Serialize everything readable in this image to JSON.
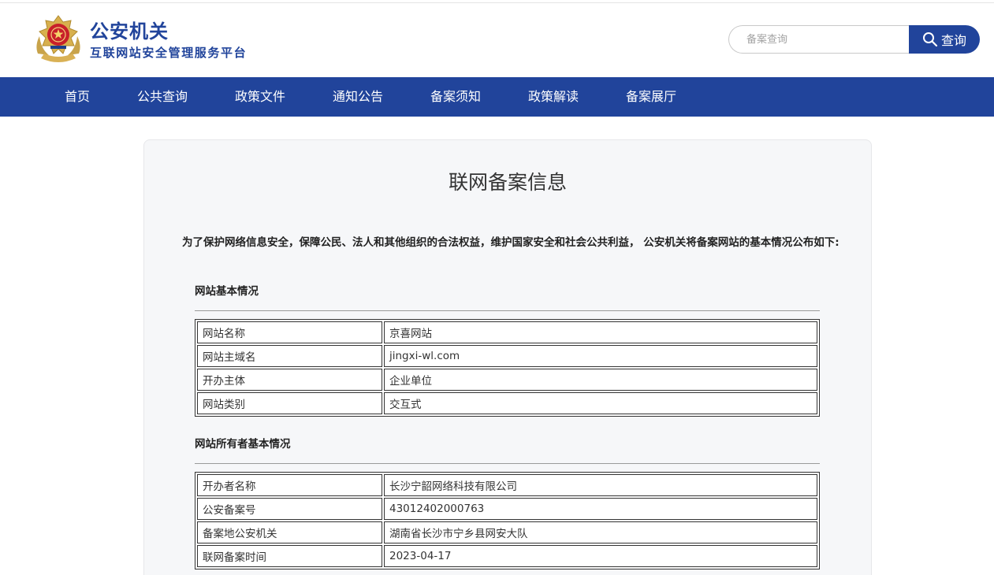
{
  "header": {
    "title": "公安机关",
    "subtitle": "互联网站安全管理服务平台",
    "emblem_icon": "police-emblem-icon",
    "brand_color": "#21449b"
  },
  "search": {
    "placeholder": "备案查询",
    "button_label": "查询",
    "icon": "search-icon"
  },
  "nav": {
    "items": [
      {
        "label": "首页"
      },
      {
        "label": "公共查询"
      },
      {
        "label": "政策文件"
      },
      {
        "label": "通知公告"
      },
      {
        "label": "备案须知"
      },
      {
        "label": "政策解读"
      },
      {
        "label": "备案展厅"
      }
    ]
  },
  "main": {
    "title": "联网备案信息",
    "intro": "为了保护网络信息安全，保障公民、法人和其他组织的合法权益，维护国家安全和社会公共利益， 公安机关将备案网站的基本情况公布如下:",
    "sections": [
      {
        "heading": "网站基本情况",
        "rows": [
          {
            "key": "网站名称",
            "value": "京喜网站"
          },
          {
            "key": "网站主域名",
            "value": "jingxi-wl.com"
          },
          {
            "key": "开办主体",
            "value": "企业单位"
          },
          {
            "key": "网站类别",
            "value": "交互式"
          }
        ]
      },
      {
        "heading": "网站所有者基本情况",
        "rows": [
          {
            "key": "开办者名称",
            "value": "长沙宁韶网络科技有限公司"
          },
          {
            "key": "公安备案号",
            "value": "43012402000763"
          },
          {
            "key": "备案地公安机关",
            "value": "湖南省长沙市宁乡县网安大队"
          },
          {
            "key": "联网备案时间",
            "value": "2023-04-17"
          }
        ]
      }
    ]
  }
}
